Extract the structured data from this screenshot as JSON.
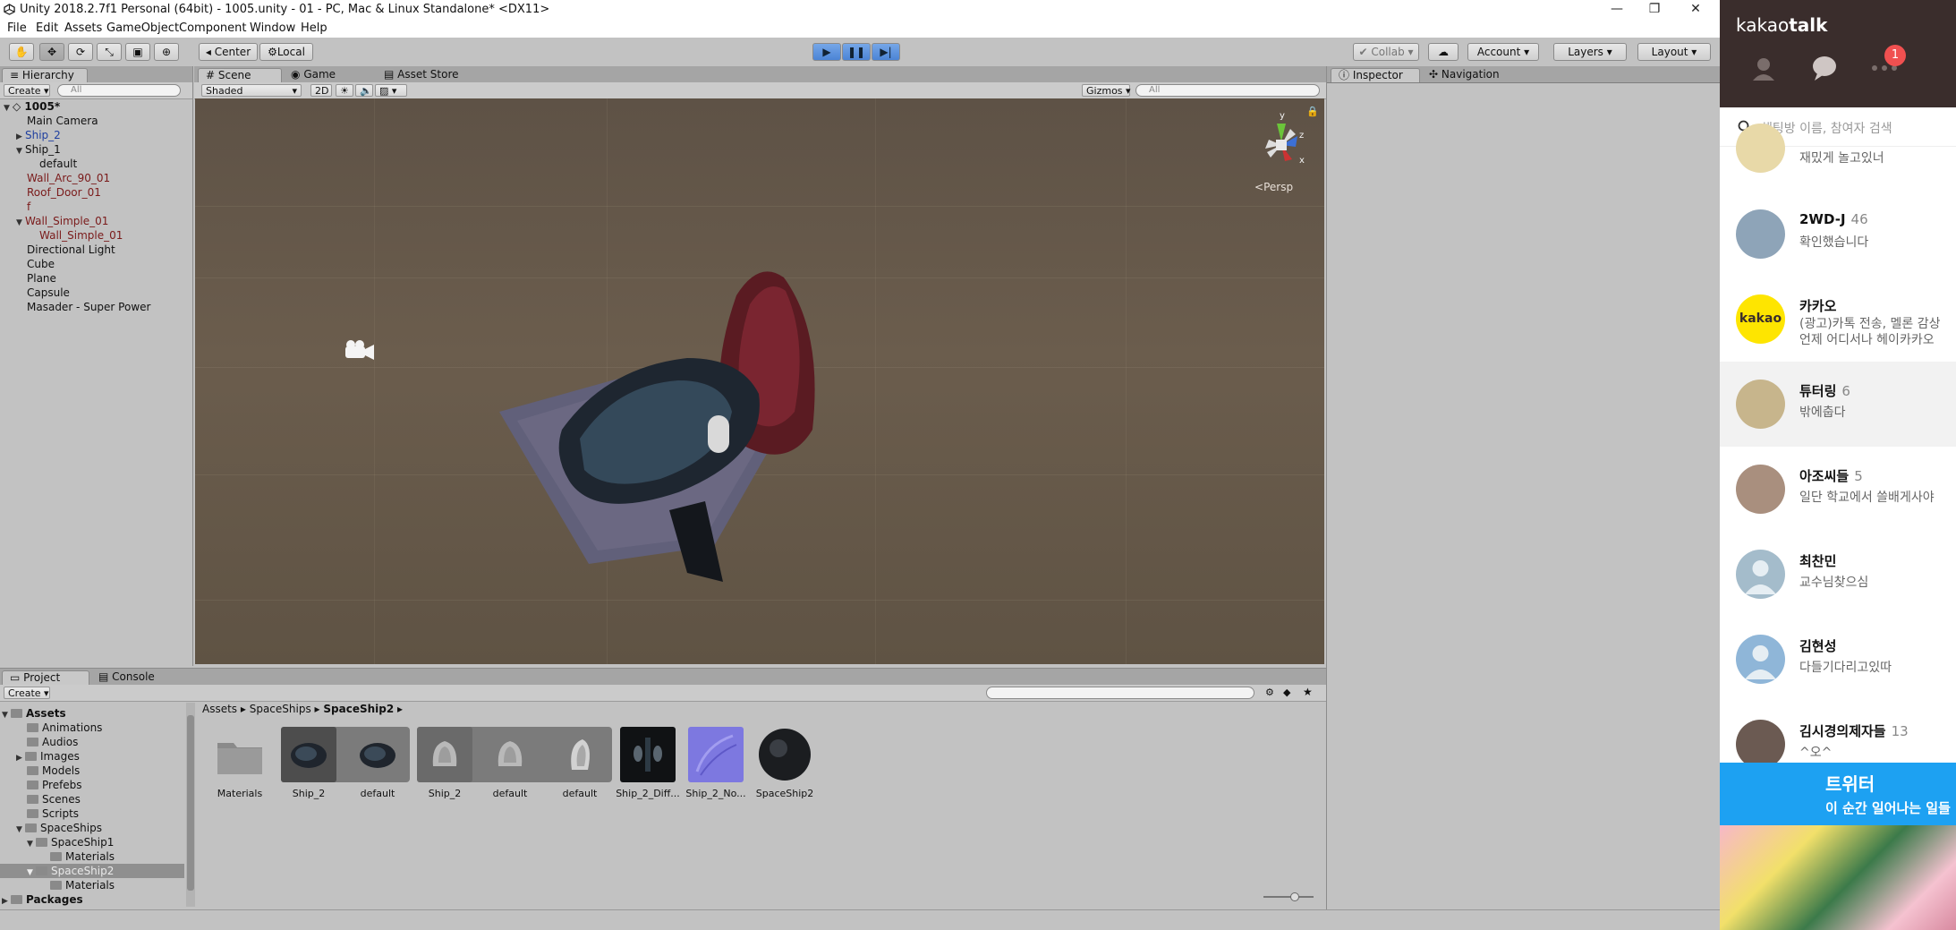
{
  "window": {
    "title": "Unity 2018.2.7f1 Personal (64bit) - 1005.unity - 01 - PC, Mac & Linux Standalone* <DX11>",
    "controls": [
      "—",
      "❐",
      "✕"
    ]
  },
  "menu": [
    "File",
    "Edit",
    "Assets",
    "GameObject",
    "Component",
    "Window",
    "Help"
  ],
  "toolbar": {
    "pivot": "Center",
    "space": "Local",
    "collab": "Collab",
    "account": "Account",
    "layers": "Layers",
    "layout": "Layout"
  },
  "hierarchy": {
    "tab": "Hierarchy",
    "create": "Create",
    "search_placeholder": "All",
    "scene": "1005*",
    "items": [
      {
        "label": "Main Camera"
      },
      {
        "label": "Ship_2"
      },
      {
        "label": "Ship_1"
      },
      {
        "label": "default"
      },
      {
        "label": "Wall_Arc_90_01"
      },
      {
        "label": "Roof_Door_01"
      },
      {
        "label": "f"
      },
      {
        "label": "Wall_Simple_01"
      },
      {
        "label": "Wall_Simple_01"
      },
      {
        "label": "Directional Light"
      },
      {
        "label": "Cube"
      },
      {
        "label": "Plane"
      },
      {
        "label": "Capsule"
      },
      {
        "label": "Masader - Super Power"
      }
    ]
  },
  "scene": {
    "tabs": [
      "Scene",
      "Game",
      "Asset Store"
    ],
    "shading": "Shaded",
    "mode2d": "2D",
    "gizmos": "Gizmos",
    "search_placeholder": "All",
    "persp": "Persp",
    "axes": {
      "y": "y",
      "z": "z",
      "x": "x"
    }
  },
  "inspector": {
    "tabs": [
      "Inspector",
      "Navigation"
    ]
  },
  "project": {
    "tabs": [
      "Project",
      "Console"
    ],
    "create": "Create",
    "breadcrumb": [
      "Assets",
      "SpaceShips",
      "SpaceShip2"
    ],
    "tree": [
      {
        "label": "Assets"
      },
      {
        "label": "Animations"
      },
      {
        "label": "Audios"
      },
      {
        "label": "Images"
      },
      {
        "label": "Models"
      },
      {
        "label": "Prefebs"
      },
      {
        "label": "Scenes"
      },
      {
        "label": "Scripts"
      },
      {
        "label": "SpaceShips"
      },
      {
        "label": "SpaceShip1"
      },
      {
        "label": "Materials"
      },
      {
        "label": "SpaceShip2"
      },
      {
        "label": "Materials"
      },
      {
        "label": "Packages"
      }
    ],
    "assets": [
      {
        "label": "Materials"
      },
      {
        "label": "Ship_2"
      },
      {
        "label": "default"
      },
      {
        "label": "Ship_2"
      },
      {
        "label": "default"
      },
      {
        "label": "default"
      },
      {
        "label": "Ship_2_Diff..."
      },
      {
        "label": "Ship_2_No..."
      },
      {
        "label": "SpaceShip2"
      }
    ]
  },
  "kakao": {
    "logo_a": "kakao",
    "logo_b": "talk",
    "badge": "1",
    "search_placeholder": "채팅방 이름, 참여자 검색",
    "partial_msg": "재밌게 놀고있너",
    "chats": [
      {
        "name": "2WD-J",
        "count": "46",
        "msg": "확인했습니다"
      },
      {
        "name": "카카오",
        "count": "",
        "msg": "(광고)카톡 전송, 멜론 감상",
        "msg2": "언제 어디서나 헤이카카오",
        "avatar_text": "kakao"
      },
      {
        "name": "튜터링",
        "count": "6",
        "msg": "밖에춥다"
      },
      {
        "name": "아조씨들",
        "count": "5",
        "msg": "일단 학교에서 쓸배게사야"
      },
      {
        "name": "최찬민",
        "count": "",
        "msg": "교수님찾으심"
      },
      {
        "name": "김현성",
        "count": "",
        "msg": "다들기다리고있따"
      },
      {
        "name": "김시경의제자들",
        "count": "13",
        "msg": "^오^"
      }
    ],
    "ad_title": "트위터",
    "ad_sub": "이 순간 일어나는 일들"
  }
}
